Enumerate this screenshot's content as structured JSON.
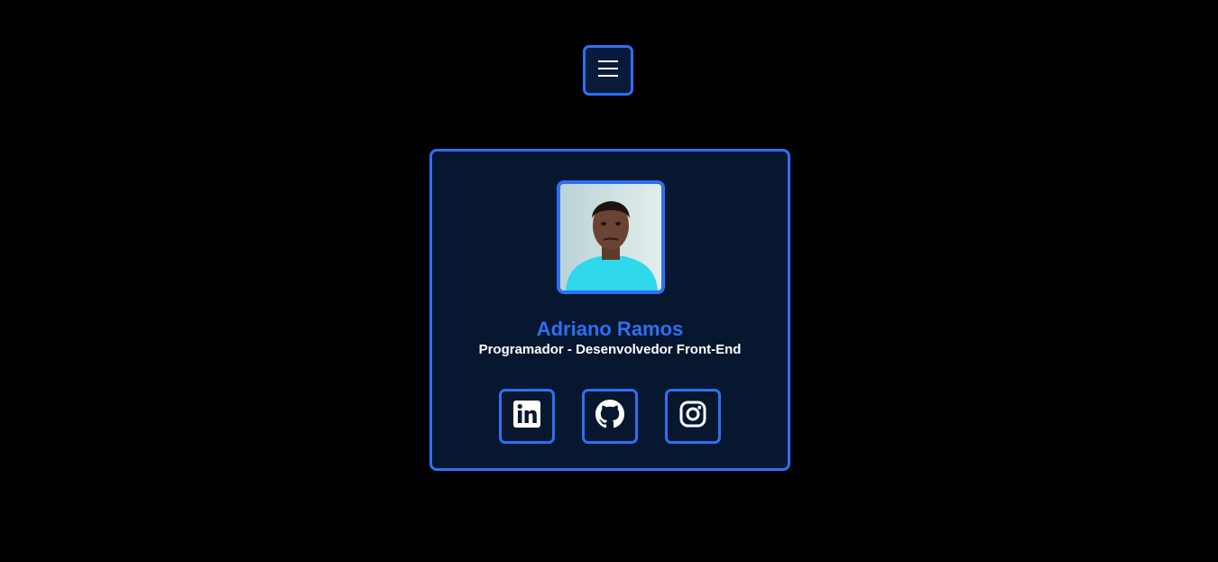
{
  "menu": {
    "icon": "hamburger-menu-icon"
  },
  "profile": {
    "name": "Adriano Ramos",
    "role": "Programador - Desenvolvedor Front-End",
    "accent_color": "#2f6ff2",
    "card_background": "#071730"
  },
  "social": [
    {
      "icon": "linkedin-icon"
    },
    {
      "icon": "github-icon"
    },
    {
      "icon": "instagram-icon"
    }
  ]
}
